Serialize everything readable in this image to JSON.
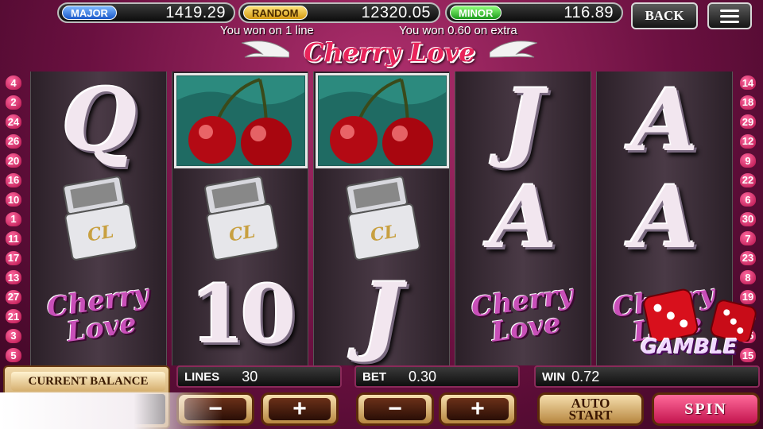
{
  "jackpots": {
    "major": {
      "label": "MAJOR",
      "value": "1419.29"
    },
    "random": {
      "label": "RANDOM",
      "value": "12320.05"
    },
    "minor": {
      "label": "MINOR",
      "value": "116.89"
    }
  },
  "top_buttons": {
    "back": "BACK",
    "menu_icon": "hamburger-menu-icon"
  },
  "messages": {
    "left": "You won on 1 line",
    "right": "You won 0.60 on extra"
  },
  "logo": {
    "text": "Cherry Love"
  },
  "reels": [
    [
      {
        "symbol": "Q"
      },
      {
        "symbol": "lighter"
      },
      {
        "symbol": "cherry-love-logo"
      }
    ],
    [
      {
        "symbol": "cherries",
        "winning": true
      },
      {
        "symbol": "lighter"
      },
      {
        "symbol": "10"
      }
    ],
    [
      {
        "symbol": "cherries",
        "winning": true
      },
      {
        "symbol": "lighter"
      },
      {
        "symbol": "J"
      }
    ],
    [
      {
        "symbol": "J"
      },
      {
        "symbol": "A"
      },
      {
        "symbol": "cherry-love-logo"
      }
    ],
    [
      {
        "symbol": "A"
      },
      {
        "symbol": "A"
      },
      {
        "symbol": "cherry-love-logo"
      }
    ]
  ],
  "symbol_text": {
    "lighter_monogram": "CL",
    "logo_line1": "Cherry",
    "logo_line2": "Love"
  },
  "line_numbers": {
    "left": [
      "4",
      "2",
      "24",
      "26",
      "20",
      "16",
      "10",
      "1",
      "11",
      "17",
      "13",
      "27",
      "21",
      "3",
      "5"
    ],
    "right": [
      "14",
      "18",
      "29",
      "12",
      "9",
      "22",
      "6",
      "30",
      "7",
      "23",
      "8",
      "19",
      "28",
      "25",
      "15"
    ]
  },
  "gamble": {
    "label": "GAMBLE"
  },
  "balance": {
    "label": "CURRENT BALANCE"
  },
  "lines": {
    "label": "LINES",
    "value": "30",
    "minus": "−",
    "plus": "+"
  },
  "bet": {
    "label": "BET",
    "value": "0.30",
    "minus": "−",
    "plus": "+"
  },
  "win": {
    "label": "WIN",
    "value": "0.72"
  },
  "auto_start": {
    "line1": "AUTO",
    "line2": "START"
  },
  "spin": {
    "label": "SPIN"
  },
  "colors": {
    "background": "#7a1448",
    "accent_pink": "#e8245a",
    "button_gold": "#d8b070",
    "spin_red": "#c3144e"
  }
}
